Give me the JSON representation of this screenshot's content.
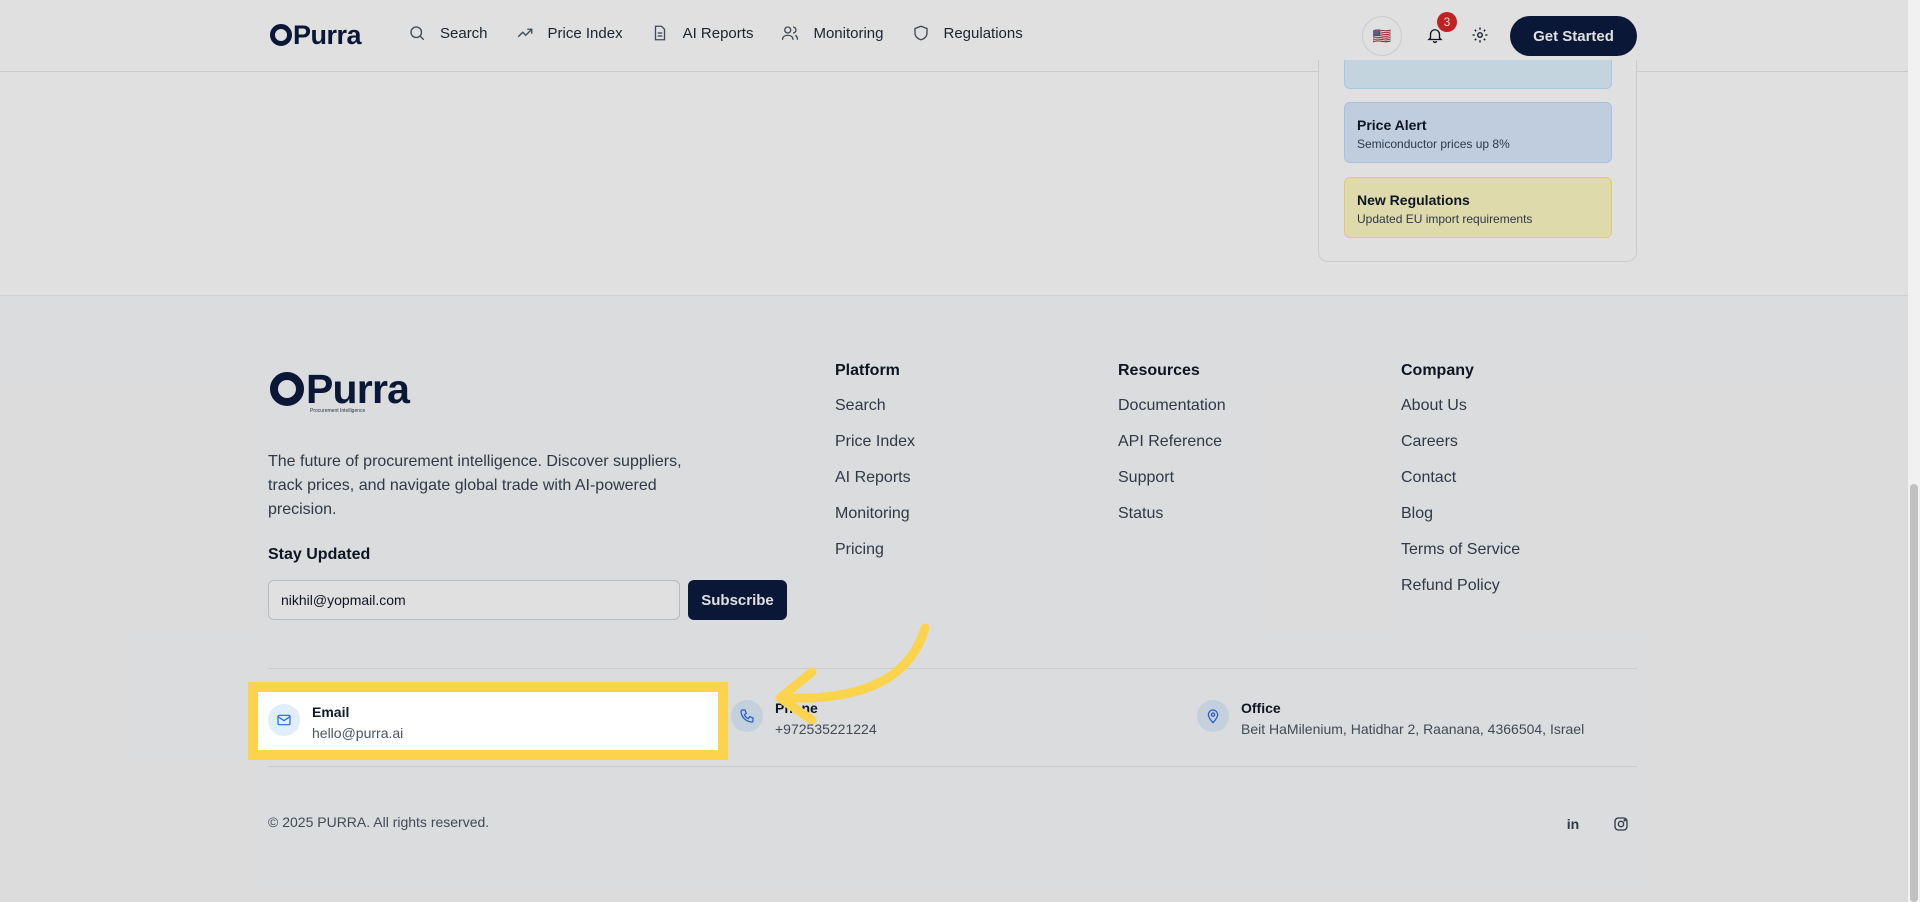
{
  "header": {
    "logo": "Purra",
    "nav": [
      {
        "label": "Search",
        "icon": "search-icon"
      },
      {
        "label": "Price Index",
        "icon": "trending-up-icon"
      },
      {
        "label": "AI Reports",
        "icon": "document-icon"
      },
      {
        "label": "Monitoring",
        "icon": "users-icon"
      },
      {
        "label": "Regulations",
        "icon": "shield-icon"
      }
    ],
    "flag": "🇺🇸",
    "notification_count": "3",
    "cta_label": "Get Started"
  },
  "alerts": [
    {
      "title": "Price Alert",
      "description": "Semiconductor prices up 8%"
    },
    {
      "title": "New Regulations",
      "description": "Updated EU import requirements"
    }
  ],
  "footer": {
    "logo": "Purra",
    "tagline": "Procurement Intelligence",
    "description": "The future of procurement intelligence. Discover suppliers, track prices, and navigate global trade with AI-powered precision.",
    "newsletter_heading": "Stay Updated",
    "newsletter_email": "nikhil@yopmail.com",
    "subscribe_label": "Subscribe",
    "columns": [
      {
        "title": "Platform",
        "links": [
          "Search",
          "Price Index",
          "AI Reports",
          "Monitoring",
          "Pricing"
        ]
      },
      {
        "title": "Resources",
        "links": [
          "Documentation",
          "API Reference",
          "Support",
          "Status"
        ]
      },
      {
        "title": "Company",
        "links": [
          "About Us",
          "Careers",
          "Contact",
          "Blog",
          "Terms of Service",
          "Refund Policy"
        ]
      }
    ],
    "contacts": [
      {
        "label": "Email",
        "value": "hello@purra.ai",
        "icon": "mail-icon"
      },
      {
        "label": "Phone",
        "value": "+972535221224",
        "icon": "phone-icon"
      },
      {
        "label": "Office",
        "value": "Beit HaMilenium, Hatidhar 2, Raanana, 4366504, Israel",
        "icon": "map-pin-icon"
      }
    ],
    "copyright": "© 2025 PURRA. All rights reserved.",
    "social": [
      "linkedin-icon",
      "instagram-icon"
    ]
  },
  "colors": {
    "brand": "#0d1b3e",
    "highlight": "#fcd34d",
    "badge": "#dc2626"
  }
}
